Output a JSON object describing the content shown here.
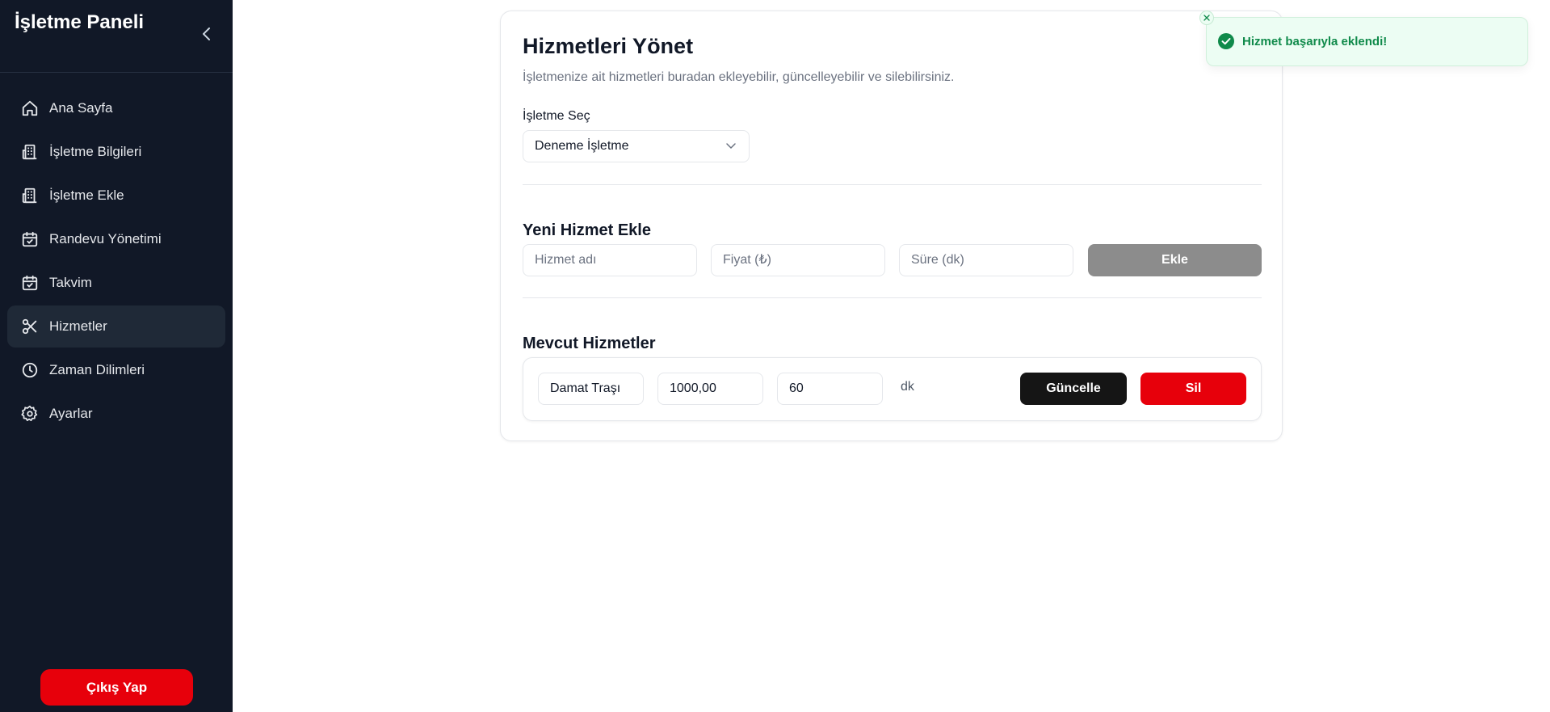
{
  "sidebar": {
    "brand": "İşletme Paneli",
    "items": [
      {
        "label": "Ana Sayfa",
        "icon": "home-icon"
      },
      {
        "label": "İşletme Bilgileri",
        "icon": "building-icon"
      },
      {
        "label": "İşletme Ekle",
        "icon": "building-add-icon"
      },
      {
        "label": "Randevu Yönetimi",
        "icon": "calendar-check-icon"
      },
      {
        "label": "Takvim",
        "icon": "calendar-icon"
      },
      {
        "label": "Hizmetler",
        "icon": "scissors-icon",
        "active": true
      },
      {
        "label": "Zaman Dilimleri",
        "icon": "clock-icon"
      },
      {
        "label": "Ayarlar",
        "icon": "gear-icon"
      }
    ],
    "logout_label": "Çıkış Yap"
  },
  "main": {
    "title": "Hizmetleri Yönet",
    "subtitle": "İşletmenize ait hizmetleri buradan ekleyebilir, güncelleyebilir ve silebilirsiniz.",
    "business_select": {
      "label": "İşletme Seç",
      "value": "Deneme İşletme"
    },
    "new_service": {
      "title": "Yeni Hizmet Ekle",
      "name_placeholder": "Hizmet adı",
      "price_placeholder": "Fiyat (₺)",
      "duration_placeholder": "Süre (dk)",
      "add_label": "Ekle"
    },
    "existing": {
      "title": "Mevcut Hizmetler",
      "services": [
        {
          "name": "Damat Traşı",
          "price": "1000,00",
          "duration": "60",
          "unit": "dk",
          "update_label": "Güncelle",
          "delete_label": "Sil"
        }
      ]
    }
  },
  "toast": {
    "message": "Hizmet başarıyla eklendi!",
    "icon": "check-circle-icon",
    "close_icon": "close-icon"
  },
  "colors": {
    "sidebar_bg": "#111827",
    "danger": "#e7000b",
    "dark_button": "#151515",
    "disabled_button": "#8c8c8c",
    "success": "#0f8a4a"
  }
}
